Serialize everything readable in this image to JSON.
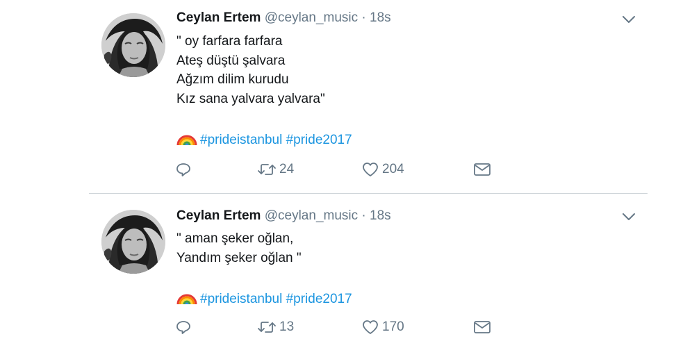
{
  "tweets": [
    {
      "author_name": "Ceylan Ertem",
      "handle": "@ceylan_music",
      "separator": "·",
      "time": "18s",
      "lines": [
        "\" oy farfara farfara",
        "Ateş düştü şalvara",
        "Ağzım dilim kurudu",
        "Kız sana yalvara yalvara\""
      ],
      "hashtags": [
        "#prideistanbul",
        "#pride2017"
      ],
      "retweets": "24",
      "likes": "204"
    },
    {
      "author_name": "Ceylan Ertem",
      "handle": "@ceylan_music",
      "separator": "·",
      "time": "18s",
      "lines": [
        "\" aman şeker oğlan,",
        "Yandım şeker oğlan \""
      ],
      "hashtags": [
        "#prideistanbul",
        "#pride2017"
      ],
      "retweets": "13",
      "likes": "170"
    }
  ],
  "icons": {
    "reply": "reply-icon",
    "retweet": "retweet-icon",
    "like": "heart-icon",
    "dm": "envelope-icon",
    "menu": "chevron-down-icon",
    "emoji": "rainbow-emoji-icon"
  },
  "colors": {
    "text": "#14171a",
    "secondary": "#657786",
    "link": "#1b95e0",
    "divider": "#cfd5da"
  }
}
